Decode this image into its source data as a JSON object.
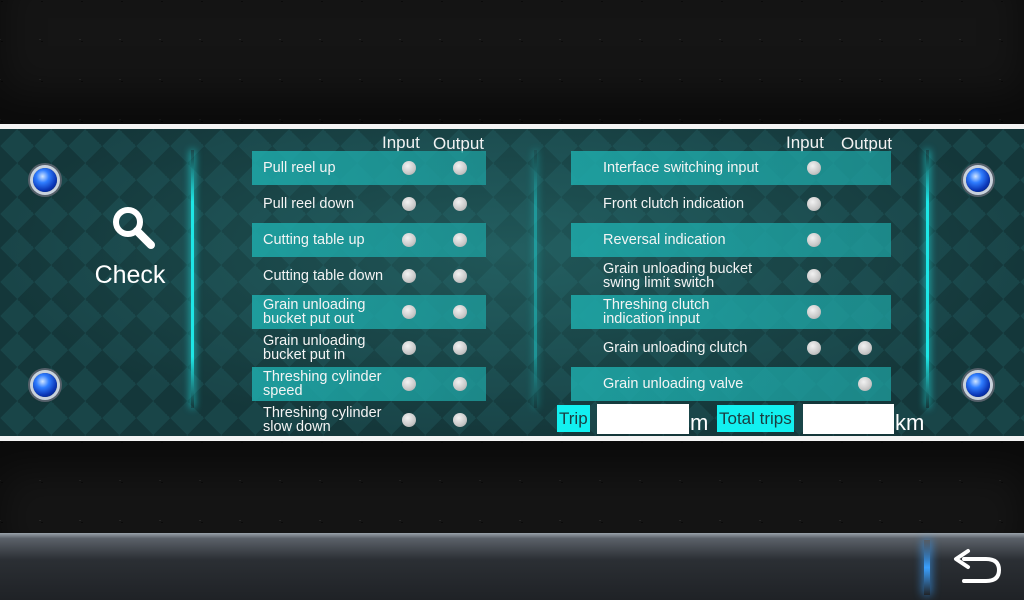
{
  "panel": {
    "title": "Check",
    "left_headers": {
      "input": "Input",
      "output": "Output"
    },
    "right_headers": {
      "input": "Input",
      "output": "Output"
    },
    "left_rows": [
      {
        "label": "Pull reel  up",
        "input": true,
        "output": true,
        "highlight": true
      },
      {
        "label": "Pull reel down",
        "input": true,
        "output": true,
        "highlight": false
      },
      {
        "label": "Cutting table  up",
        "input": true,
        "output": true,
        "highlight": true
      },
      {
        "label": "Cutting table down",
        "input": true,
        "output": true,
        "highlight": false
      },
      {
        "label": "Grain unloading\nbucket put out",
        "input": true,
        "output": true,
        "highlight": true
      },
      {
        "label": "Grain unloading\nbucket put in",
        "input": true,
        "output": true,
        "highlight": false
      },
      {
        "label": "Threshing cylinder\nspeed",
        "input": true,
        "output": true,
        "highlight": true
      },
      {
        "label": "Threshing cylinder\nslow down",
        "input": true,
        "output": true,
        "highlight": false
      }
    ],
    "right_rows": [
      {
        "label": "Interface switching input",
        "input": true,
        "output": false,
        "highlight": true
      },
      {
        "label": "Front clutch indication",
        "input": true,
        "output": false,
        "highlight": false
      },
      {
        "label": "Reversal indication",
        "input": true,
        "output": false,
        "highlight": true
      },
      {
        "label": "Grain unloading bucket\nswing limit switch",
        "input": true,
        "output": false,
        "highlight": false
      },
      {
        "label": "Threshing clutch\nindication input",
        "input": true,
        "output": false,
        "highlight": true
      },
      {
        "label": "Grain unloading clutch",
        "input": true,
        "output": true,
        "highlight": false
      },
      {
        "label": "Grain unloading valve",
        "input": false,
        "output": true,
        "highlight": true
      }
    ],
    "trip": {
      "label": "Trip",
      "value": "",
      "unit": "m"
    },
    "total_trips": {
      "label": "Total trips",
      "value": "",
      "unit": "km"
    }
  },
  "icons": {
    "search": "search-icon",
    "back": "back-arrow-icon"
  },
  "colors": {
    "accent": "#12f0f0",
    "row_highlight": "#1eaaaa",
    "panel_bg": "#1d4c50",
    "screw": "#2f7dff"
  }
}
